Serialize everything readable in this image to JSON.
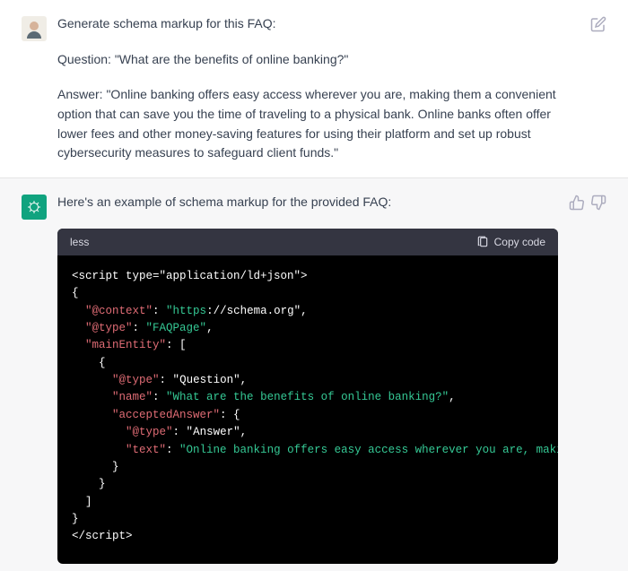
{
  "user": {
    "p1": "Generate schema markup for this FAQ:",
    "p2": "Question: \"What are the benefits of online banking?\"",
    "p3": "Answer: \"Online banking offers easy access wherever you are, making them a convenient option that can save you the time of traveling to a physical bank. Online banks often offer lower fees and other money-saving features for using their platform and set up robust cybersecurity measures to safeguard client funds.\""
  },
  "assistant": {
    "intro": "Here's an example of schema markup for the provided FAQ:"
  },
  "code": {
    "lang": "less",
    "copy_label": "Copy code",
    "lines": {
      "open_script": "<script type=\"application/ld+json\">",
      "open_brace": "{",
      "k_context": "\"@context\"",
      "v_context_prefix": "\"https",
      "v_context_suffix": "://schema.org\"",
      "k_type": "\"@type\"",
      "v_faqpage": "\"FAQPage\"",
      "k_main": "\"mainEntity\"",
      "open_arr": ": [",
      "open_obj": "    {",
      "k_qtype": "\"@type\"",
      "v_question": "Question",
      "k_name": "\"name\"",
      "v_name": "\"What are the benefits of online banking?\"",
      "k_accepted": "\"acceptedAnswer\"",
      "open_obj2": ": {",
      "k_atype": "\"@type\"",
      "v_answer": "Answer",
      "k_text": "\"text\"",
      "v_text": "\"Online banking offers easy access wherever you are, making them a",
      "close_obj2": "      }",
      "close_obj": "    }",
      "close_arr": "  ]",
      "close_brace": "}",
      "close_script": "</script>"
    }
  }
}
